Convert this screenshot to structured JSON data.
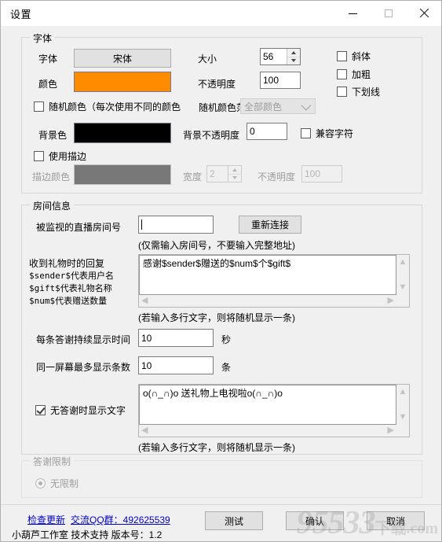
{
  "window": {
    "title": "设置",
    "minimize": "minimize-icon",
    "maximize": "maximize-icon",
    "close": "close-icon"
  },
  "font_group": {
    "title": "字体",
    "font_label": "字体",
    "font_value": "宋体",
    "size_label": "大小",
    "size_value": "56",
    "color_label": "颜色",
    "color_value": "#FF8C00",
    "opacity_label": "不透明度",
    "opacity_value": "100",
    "italic_label": "斜体",
    "bold_label": "加粗",
    "underline_label": "下划线",
    "random_color_label": "随机颜色（每次使用不同的颜色",
    "random_range_label": "随机颜色范围",
    "random_range_value": "全部颜色",
    "bg_color_label": "背景色",
    "bg_color_value": "#000000",
    "bg_opacity_label": "背景不透明度",
    "bg_opacity_value": "0",
    "compat_label": "兼容字符",
    "use_stroke_label": "使用描边",
    "stroke_color_label": "描边颜色",
    "stroke_color_value": "#787878",
    "stroke_width_label": "宽度",
    "stroke_width_value": "2",
    "stroke_opacity_label": "不透明度",
    "stroke_opacity_value": "100"
  },
  "room_group": {
    "title": "房间信息",
    "room_label": "被监视的直播房间号",
    "room_value": "",
    "reconnect_button": "重新连接",
    "room_hint": "(仅需输入房间号，不要输入完整地址)",
    "reply_label_lines": [
      "收到礼物时的回复",
      "$sender$代表用户名",
      "$gift$代表礼物名称",
      "$num$代表赠送数量"
    ],
    "reply_value": "感谢$sender$赠送的$num$个$gift$",
    "reply_hint": "(若输入多行文字，则将随机显示一条)",
    "duration_label": "每条答谢持续显示时间",
    "duration_value": "10",
    "duration_unit": "秒",
    "maxcount_label": "同一屏幕最多显示条数",
    "maxcount_value": "10",
    "maxcount_unit": "条",
    "idle_checkbox_label": "无答谢时显示文字",
    "idle_value": "o(∩_∩)o 送礼物上电视啦o(∩_∩)o",
    "idle_hint": "(若输入多行文字，则将随机显示一条)"
  },
  "limit_group": {
    "title": "答谢限制",
    "option_label": "无限制"
  },
  "footer": {
    "check_update_link": "检查更新",
    "qq_group_link": "交流QQ群：492625539",
    "credit": "小葫芦工作室  技术支持  版本号：1.2",
    "test_button": "测试",
    "confirm_button": "确认",
    "cancel_button": "取消"
  },
  "watermark": {
    "main": "95533",
    "suffix": "下载",
    "domain": ".com"
  }
}
